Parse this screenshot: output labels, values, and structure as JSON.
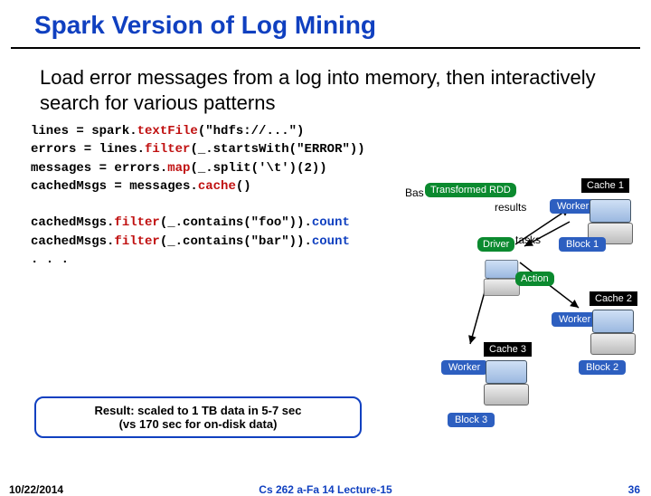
{
  "title": "Spark Version of Log Mining",
  "subtitle": "Load error messages from a log into memory, then interactively search for various patterns",
  "code": {
    "l1a": "lines = spark.",
    "l1b": "textFile",
    "l1c": "(\"hdfs://...\")",
    "l2a": "errors = lines.",
    "l2b": "filter",
    "l2c": "(_.startsWith(\"ERROR\"))",
    "l3a": "messages = errors.",
    "l3b": "map",
    "l3c": "(_.split('\\t')(2))",
    "l4a": "cachedMsgs = messages.",
    "l4b": "cache",
    "l4c": "()",
    "gap": "",
    "l5a": "cachedMsgs.",
    "l5b": "filter",
    "l5c": "(_.contains(\"foo\")).",
    "l5d": "count",
    "l6a": "cachedMsgs.",
    "l6b": "filter",
    "l6c": "(_.contains(\"bar\")).",
    "l6d": "count",
    "l7": ". . ."
  },
  "result_box": "Result: scaled to 1 TB data in 5-7 sec\n(vs 170 sec for on-disk data)",
  "diagram": {
    "bas": "Bas",
    "transformed": "Transformed RDD",
    "results": "results",
    "tasks": "tasks",
    "driver": "Driver",
    "action": "Action",
    "worker": "Worker",
    "cache1": "Cache 1",
    "cache2": "Cache 2",
    "cache3": "Cache 3",
    "block1": "Block 1",
    "block2": "Block 2",
    "block3": "Block 3"
  },
  "footer": {
    "date": "10/22/2014",
    "mid": "Cs 262 a-Fa 14 Lecture-15",
    "num": "36"
  }
}
